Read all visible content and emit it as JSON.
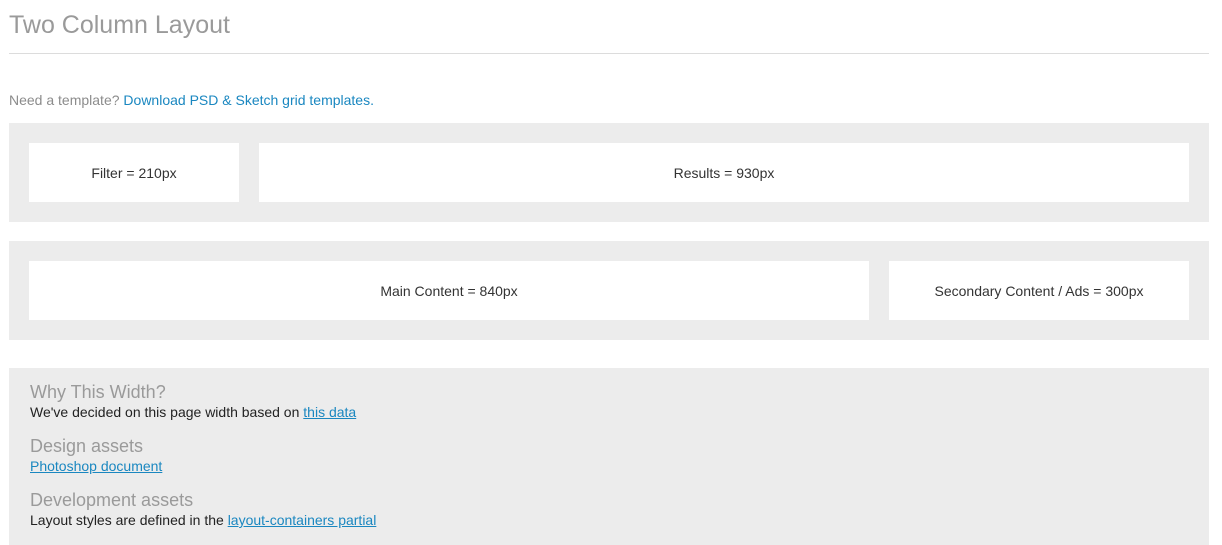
{
  "header": {
    "title": "Two Column Layout"
  },
  "template_note": {
    "prefix": "Need a template?",
    "link_text": "Download PSD & Sketch grid templates."
  },
  "rows": [
    {
      "cells": [
        {
          "label": "Filter = 210px"
        },
        {
          "label": "Results = 930px"
        }
      ]
    },
    {
      "cells": [
        {
          "label": "Main Content = 840px"
        },
        {
          "label": "Secondary Content / Ads = 300px"
        }
      ]
    }
  ],
  "info": {
    "why": {
      "heading": "Why This Width?",
      "text": "We've decided on this page width based on ",
      "link_text": "this data"
    },
    "design": {
      "heading": "Design assets",
      "link_text": "Photoshop document"
    },
    "development": {
      "heading": "Development assets",
      "text": "Layout styles are defined in the ",
      "link_text": "layout-containers partial"
    }
  },
  "colors": {
    "link": "#1a87c0",
    "panel_bg": "#ececec",
    "heading_gray": "#9a9a9a"
  }
}
